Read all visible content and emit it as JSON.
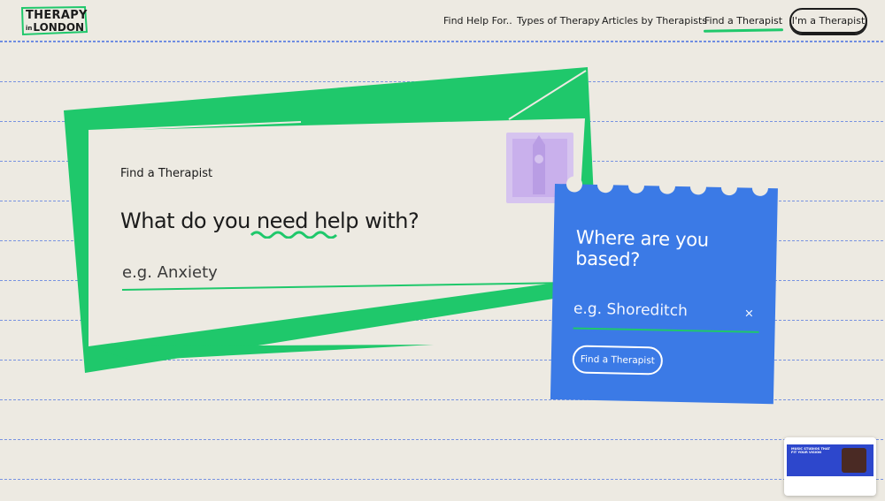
{
  "header": {
    "logo": {
      "line1": "THERAPY",
      "line2_small": "in",
      "line2": "LONDON"
    },
    "nav": [
      {
        "label": "Find Help For..",
        "active": false
      },
      {
        "label": "Types of Therapy",
        "active": false
      },
      {
        "label": "Articles by Therapists",
        "active": false
      },
      {
        "label": "Find a Therapist",
        "active": true
      }
    ],
    "cta_label": "I'm a Therapist"
  },
  "search_card": {
    "label": "Find a Therapist",
    "question": {
      "before": "What do you ",
      "highlight": "need help",
      "after": " with?"
    },
    "input_placeholder": "e.g. Anxiety"
  },
  "location_card": {
    "title": "Where are you based?",
    "input_placeholder": "e.g. Shoreditch",
    "clear_symbol": "×",
    "button_label": "Find a Therapist"
  },
  "thumbnail": {
    "heading": "MUSIC STUDIOS THAT FIT YOUR VISION"
  },
  "colors": {
    "background": "#edeae2",
    "accent_green": "#1fc86b",
    "accent_blue": "#3b7ae6",
    "stamp_purple": "#d6c4ef",
    "text": "#1b1b1b"
  },
  "icons": [
    "close-icon",
    "big-ben-stamp-icon"
  ]
}
